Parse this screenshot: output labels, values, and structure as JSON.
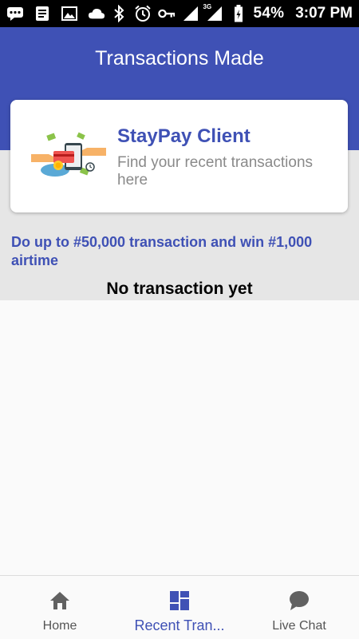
{
  "status_bar": {
    "battery": "54%",
    "time": "3:07 PM",
    "network": "3G",
    "icons": [
      "chat-bubble-icon",
      "notes-icon",
      "image-icon",
      "cloud-icon",
      "bluetooth-icon",
      "alarm-icon",
      "key-icon",
      "signal-icon",
      "signal-3g-icon",
      "battery-icon"
    ]
  },
  "app_bar": {
    "title": "Transactions Made"
  },
  "card": {
    "title": "StayPay Client",
    "subtitle": "Find your recent transactions here",
    "illustration": "payment-illustration"
  },
  "promo_text": "Do up to #50,000 transaction and win #1,000 airtime",
  "empty_message": "No transaction yet",
  "bottom_nav": {
    "items": [
      {
        "label": "Home",
        "icon": "home-icon",
        "active": false
      },
      {
        "label": "Recent Tran...",
        "icon": "dashboard-icon",
        "active": true
      },
      {
        "label": "Live Chat",
        "icon": "chat-icon",
        "active": false
      }
    ]
  },
  "colors": {
    "primary": "#3f51b5",
    "status_bar": "#000000",
    "band": "#e6e6e6",
    "background": "#fafafa"
  }
}
